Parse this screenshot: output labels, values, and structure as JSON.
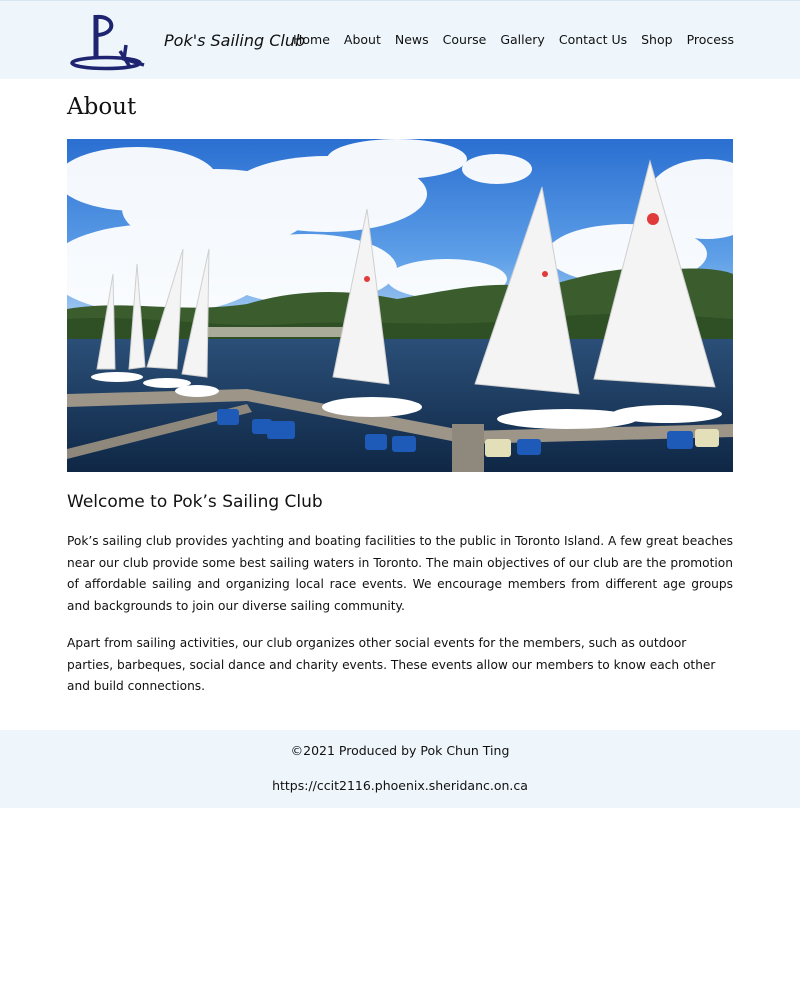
{
  "header": {
    "brand": "Pok's Sailing Club",
    "nav": [
      "Home",
      "About",
      "News",
      "Course",
      "Gallery",
      "Contact Us",
      "Shop",
      "Process"
    ]
  },
  "main": {
    "title": "About",
    "subtitle": "Welcome to Pok’s Sailing Club",
    "paragraphs": [
      "Pok’s sailing club provides yachting and boating facilities to the public in Toronto Island. A few great beaches near our club provide some best sailing waters in Toronto. The main objectives of our club are the promotion of affordable sailing and organizing local race events. We encourage members from different age groups and backgrounds to join our diverse sailing community.",
      "Apart from sailing activities, our club organizes other social events for the members, such as outdoor parties, barbeques, social dance and charity events. These events allow our members to know each other and build connections."
    ]
  },
  "footer": {
    "credit": "©2021 Produced by Pok Chun Ting",
    "url": "https://ccit2116.phoenix.sheridanc.on.ca"
  },
  "colors": {
    "header_bg": "#eef6fc",
    "logo": "#1f2470"
  },
  "icons": {
    "logo": "sailing-club-logo"
  }
}
